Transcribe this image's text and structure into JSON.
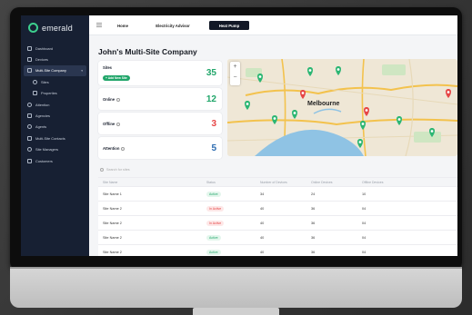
{
  "colors": {
    "brand": "#3ccf8e",
    "sidebar": "#172033",
    "active_tab": "#121826",
    "pin_green": "#2bb673",
    "pin_red": "#e64646"
  },
  "brand": {
    "name": "emerald"
  },
  "sidebar": {
    "items": [
      {
        "label": "Dashboard",
        "icon": "grid-icon"
      },
      {
        "label": "Devices",
        "icon": "device-icon"
      },
      {
        "label": "Multi-Site Company",
        "icon": "building-icon",
        "active": true
      },
      {
        "label": "Sites",
        "icon": "circle-icon",
        "sub": true
      },
      {
        "label": "Properties",
        "icon": "home-icon",
        "sub": true
      },
      {
        "label": "Attention",
        "icon": "alert-icon"
      },
      {
        "label": "Agencies",
        "icon": "agency-icon"
      },
      {
        "label": "Agents",
        "icon": "user-icon"
      },
      {
        "label": "Multi-Site Contacts",
        "icon": "contacts-icon"
      },
      {
        "label": "Site Managers",
        "icon": "user-icon"
      },
      {
        "label": "Customers",
        "icon": "users-icon"
      }
    ]
  },
  "topbar": {
    "tabs": [
      "Home",
      "Electricity Advisor",
      "Heat Pump"
    ],
    "active_tab": "Heat Pump"
  },
  "page": {
    "title": "John's Multi-Site Company"
  },
  "cards": {
    "sites": {
      "label": "Sites",
      "value": "35",
      "add_label": "+ Add New Site",
      "color": "#21a66a"
    },
    "online": {
      "label": "Online",
      "value": "12",
      "color": "#21a66a"
    },
    "offline": {
      "label": "Offline",
      "value": "3",
      "color": "#e64646"
    },
    "attention": {
      "label": "Attention",
      "value": "5",
      "color": "#2b6bb0"
    }
  },
  "map": {
    "city_label": "Melbourne"
  },
  "search": {
    "placeholder": "Search for sites"
  },
  "table": {
    "headers": [
      "Site Name",
      "Status",
      "Number of Devices",
      "Online Devices",
      "Offline Devices"
    ],
    "rows": [
      {
        "name": "Site Name 1",
        "status": "Active",
        "devices": "34",
        "online": "24",
        "offline": "10"
      },
      {
        "name": "Site Name 2",
        "status": "In Active",
        "devices": "40",
        "online": "36",
        "offline": "04"
      },
      {
        "name": "Site Name 2",
        "status": "In Active",
        "devices": "40",
        "online": "36",
        "offline": "04"
      },
      {
        "name": "Site Name 2",
        "status": "Active",
        "devices": "40",
        "online": "36",
        "offline": "04"
      },
      {
        "name": "Site Name 2",
        "status": "Active",
        "devices": "40",
        "online": "36",
        "offline": "04"
      }
    ]
  }
}
